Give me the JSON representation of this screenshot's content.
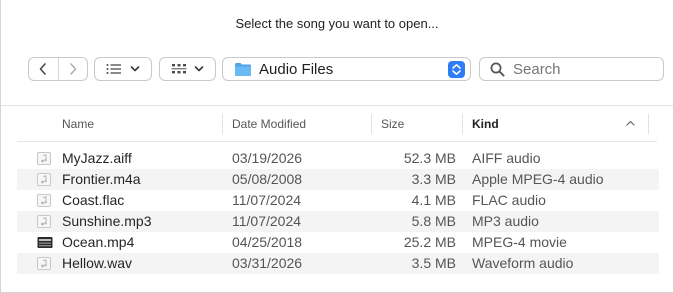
{
  "dialog": {
    "title": "Select the song you want to open..."
  },
  "toolbar": {
    "back_icon": "chevron-left-icon",
    "forward_icon": "chevron-right-icon",
    "view_list_icon": "list-view-icon",
    "view_grid_icon": "grid-view-icon",
    "location": "Audio Files",
    "search_placeholder": "Search"
  },
  "columns": {
    "name": "Name",
    "date": "Date Modified",
    "size": "Size",
    "kind": "Kind",
    "sort_indicator": "^"
  },
  "files": [
    {
      "name": "MyJazz.aiff",
      "date": "03/19/2026",
      "size": "52.3 MB",
      "kind": "AIFF audio",
      "icon": "audio-file-icon"
    },
    {
      "name": "Frontier.m4a",
      "date": "05/08/2008",
      "size": "3.3 MB",
      "kind": "Apple MPEG-4 audio",
      "icon": "audio-file-icon"
    },
    {
      "name": "Coast.flac",
      "date": "11/07/2024",
      "size": "4.1 MB",
      "kind": "FLAC audio",
      "icon": "audio-file-icon"
    },
    {
      "name": "Sunshine.mp3",
      "date": "11/07/2024",
      "size": "5.8 MB",
      "kind": "MP3 audio",
      "icon": "audio-file-icon"
    },
    {
      "name": "Ocean.mp4",
      "date": "04/25/2018",
      "size": "25.2 MB",
      "kind": "MPEG-4 movie",
      "icon": "movie-file-icon"
    },
    {
      "name": "Hellow.wav",
      "date": "03/31/2026",
      "size": "3.5 MB",
      "kind": "Waveform audio",
      "icon": "audio-file-icon"
    }
  ],
  "colors": {
    "accent": "#2f7cf6",
    "folder": "#5aaef0",
    "alt_row": "#f4f4f5"
  }
}
